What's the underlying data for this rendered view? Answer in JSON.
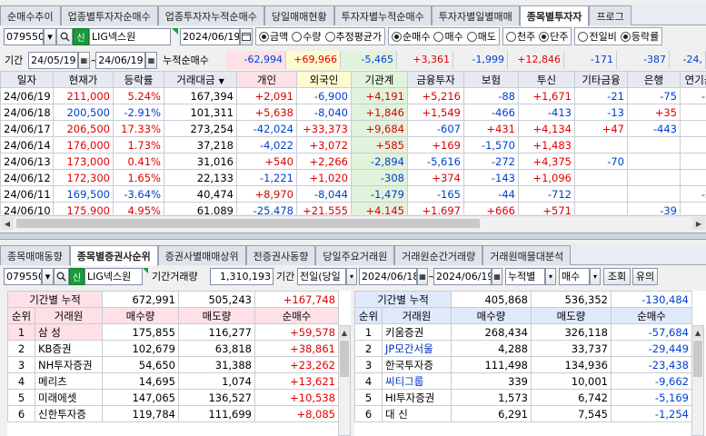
{
  "top_tabs": [
    "순매수추이",
    "업종별투자자순매수",
    "업종투자자누적순매수",
    "당일매매현황",
    "투자자별누적순매수",
    "투자자별일별매매",
    "종목별투자자",
    "프로그"
  ],
  "top_active_tab": 6,
  "top_controls": {
    "code": "079550",
    "badge": "신",
    "name": "LIG넥스원",
    "date": "2024/06/19",
    "unit_radios": [
      {
        "label": "금액",
        "on": true
      },
      {
        "label": "수량",
        "on": false
      },
      {
        "label": "추정평균가",
        "on": false
      }
    ],
    "type_radios": [
      {
        "label": "순매수",
        "on": true
      },
      {
        "label": "매수",
        "on": false
      },
      {
        "label": "매도",
        "on": false
      }
    ],
    "unit2_radios": [
      {
        "label": "천주",
        "on": false
      },
      {
        "label": "단주",
        "on": true
      }
    ],
    "compare_radios": [
      {
        "label": "전일비",
        "on": false
      },
      {
        "label": "등락률",
        "on": true
      }
    ]
  },
  "period_row": {
    "label": "기간",
    "from": "24/05/19",
    "to": "24/06/19",
    "cum_label": "누적순매수",
    "values": [
      "-62,994",
      "+69,966",
      "-5,465",
      "+3,361",
      "-1,999",
      "+12,846",
      "-171",
      "-387",
      "-24,"
    ]
  },
  "top_table": {
    "headers": [
      "일자",
      "현재가",
      "등락률",
      "거래대금",
      "개인",
      "외국인",
      "기관계",
      "금융투자",
      "보험",
      "투신",
      "기타금융",
      "은행",
      "연기금"
    ],
    "rows": [
      [
        "24/06/19",
        "211,000",
        "5.24%",
        "167,394",
        "+2,091",
        "-6,900",
        "+4,191",
        "+5,216",
        "-88",
        "+1,671",
        "-21",
        "-75",
        "-1,"
      ],
      [
        "24/06/18",
        "200,500",
        "-2.91%",
        "101,311",
        "+5,638",
        "-8,040",
        "+1,846",
        "+1,549",
        "-466",
        "-413",
        "-13",
        "+35",
        "+"
      ],
      [
        "24/06/17",
        "206,500",
        "17.33%",
        "273,254",
        "-42,024",
        "+33,373",
        "+9,684",
        "-607",
        "+431",
        "+4,134",
        "+47",
        "-443",
        "+"
      ],
      [
        "24/06/14",
        "176,000",
        "1.73%",
        "37,218",
        "-4,022",
        "+3,072",
        "+585",
        "+169",
        "-1,570",
        "+1,483",
        "",
        "",
        "-"
      ],
      [
        "24/06/13",
        "173,000",
        "0.41%",
        "31,016",
        "+540",
        "+2,266",
        "-2,894",
        "-5,616",
        "-272",
        "+4,375",
        "-70",
        "",
        "-"
      ],
      [
        "24/06/12",
        "172,300",
        "1.65%",
        "22,133",
        "-1,221",
        "+1,020",
        "-308",
        "+374",
        "-143",
        "+1,096",
        "",
        "",
        "-"
      ],
      [
        "24/06/11",
        "169,500",
        "-3.64%",
        "40,474",
        "+8,970",
        "-8,044",
        "-1,479",
        "-165",
        "-44",
        "-712",
        "",
        "",
        "-2,"
      ],
      [
        "24/06/10",
        "175,900",
        "4.95%",
        "61,089",
        "-25,478",
        "+21,555",
        "+4,145",
        "+1,697",
        "+666",
        "+571",
        "",
        "-39",
        ""
      ]
    ]
  },
  "bottom_tabs": [
    "종목매매동향",
    "종목별증권사순위",
    "증권사별매매상위",
    "전증권사동향",
    "당일주요거래원",
    "거래원순간거래량",
    "거래원매물대분석"
  ],
  "bottom_active_tab": 1,
  "bottom_controls": {
    "code": "079550",
    "badge": "신",
    "name": "LIG넥스원",
    "vol_label": "기간거래량",
    "vol_value": "1,310,193",
    "period_label": "기간",
    "period_select": "전일(당일",
    "from": "2024/06/18",
    "to": "2024/06/19",
    "cum_select": "누적별",
    "side_select": "매수",
    "query_btn": "조회",
    "extra_btn": "유의"
  },
  "left_rank": {
    "sum_label": "기간별 누적",
    "sums": [
      "672,991",
      "505,243",
      "+167,748"
    ],
    "headers": [
      "순위",
      "거래원",
      "매수량",
      "매도량",
      "순매수"
    ],
    "rows": [
      [
        "1",
        "삼 성",
        "175,855",
        "116,277",
        "+59,578"
      ],
      [
        "2",
        "KB증권",
        "102,679",
        "63,818",
        "+38,861"
      ],
      [
        "3",
        "NH투자증권",
        "54,650",
        "31,388",
        "+23,262"
      ],
      [
        "4",
        "메리츠",
        "14,695",
        "1,074",
        "+13,621"
      ],
      [
        "5",
        "미래에셋",
        "147,065",
        "136,527",
        "+10,538"
      ],
      [
        "6",
        "신한투자증",
        "119,784",
        "111,699",
        "+8,085"
      ]
    ]
  },
  "right_rank": {
    "sum_label": "기간별 누적",
    "sums": [
      "405,868",
      "536,352",
      "-130,484"
    ],
    "headers": [
      "순위",
      "거래원",
      "매수량",
      "매도량",
      "순매수"
    ],
    "rows": [
      [
        "1",
        "키움증권",
        "268,434",
        "326,118",
        "-57,684"
      ],
      [
        "2",
        "JP모간서울",
        "4,288",
        "33,737",
        "-29,449"
      ],
      [
        "3",
        "한국투자증",
        "111,498",
        "134,936",
        "-23,438"
      ],
      [
        "4",
        "씨티그룹",
        "339",
        "10,001",
        "-9,662"
      ],
      [
        "5",
        "HI투자증권",
        "1,573",
        "6,742",
        "-5,169"
      ],
      [
        "6",
        "대 신",
        "6,291",
        "7,545",
        "-1,254"
      ]
    ]
  },
  "colors": {
    "up": "#e00000",
    "down": "#0040d0",
    "accent_green": "#1a9a3a"
  }
}
